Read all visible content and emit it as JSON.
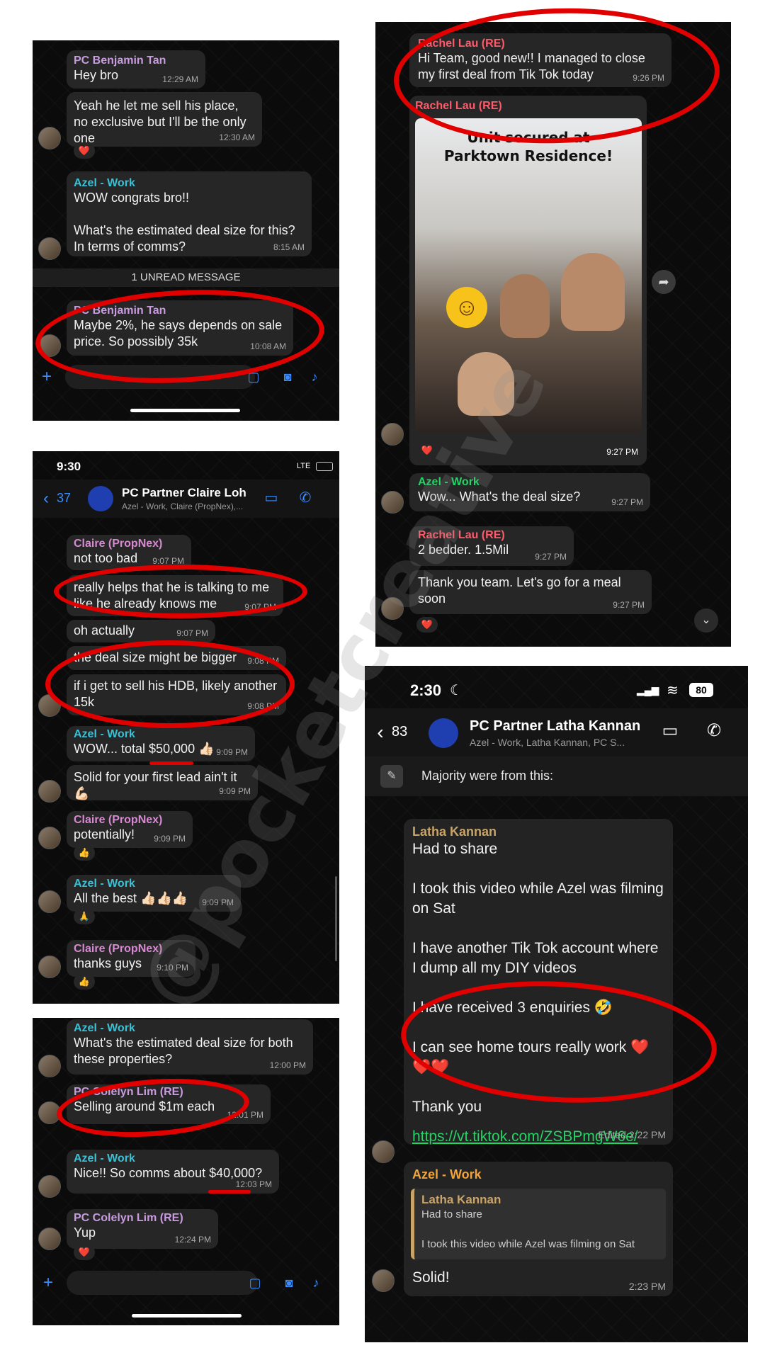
{
  "p1": {
    "m1_sender": "PC Benjamin Tan",
    "m1_text": "Hey bro",
    "m1_time": "12:29 AM",
    "m2_text": "Yeah he let me sell his place, no exclusive but I'll be the only one",
    "m2_time": "12:30 AM",
    "m2_react": "❤️",
    "m3_sender": "Azel - Work",
    "m3_text": "WOW congrats bro!!\n\nWhat's the estimated deal size for this? In terms of comms?",
    "m3_time": "8:15 AM",
    "unread": "1 UNREAD MESSAGE",
    "m4_sender": "PC Benjamin Tan",
    "m4_text": "Maybe 2%, he says depends on sale price. So possibly 35k",
    "m4_time": "10:08 AM"
  },
  "p2": {
    "status_time": "9:30",
    "status_net": "LTE",
    "back_count": "37",
    "title": "PC Partner Claire Loh",
    "subtitle": "Azel - Work, Claire (PropNex),...",
    "m1_sender": "Claire (PropNex)",
    "m1_text": "not too bad",
    "m1_time": "9:07 PM",
    "m2_text": "really helps that he is talking to me like he already knows me",
    "m2_time": "9:07 PM",
    "m3_text": "oh actually",
    "m3_time": "9:07 PM",
    "m4_text": "the deal size might be bigger",
    "m4_time": "9:08 PM",
    "m5_text": "if i get to sell his HDB, likely another 15k",
    "m5_time": "9:08 PM",
    "m6_sender": "Azel - Work",
    "m6_text": "WOW... total $50,000 👍🏻",
    "m6_time": "9:09 PM",
    "m7_text": "Solid for your first lead ain't it 💪🏻",
    "m7_time": "9:09 PM",
    "m8_sender": "Claire (PropNex)",
    "m8_text": "potentially!",
    "m8_time": "9:09 PM",
    "m8_react": "👍",
    "m9_sender": "Azel - Work",
    "m9_text": "All the best 👍🏻👍🏻👍🏻",
    "m9_time": "9:09 PM",
    "m9_react": "🙏",
    "m10_sender": "Claire (PropNex)",
    "m10_text": "thanks guys",
    "m10_time": "9:10 PM",
    "m10_react": "👍"
  },
  "p3": {
    "m1_sender": "Azel - Work",
    "m1_text": "What's the estimated deal size for both these properties?",
    "m1_time": "12:00 PM",
    "m2_sender": "PC Colelyn Lim (RE)",
    "m2_text": "Selling around $1m each",
    "m2_time": "12:01 PM",
    "m3_sender": "Azel - Work",
    "m3_text": "Nice!! So comms about $40,000?",
    "m3_time": "12:03 PM",
    "m4_sender": "PC Colelyn Lim (RE)",
    "m4_text": "Yup",
    "m4_time": "12:24 PM",
    "m4_react": "❤️"
  },
  "p4": {
    "m1_sender": "Rachel Lau (RE)",
    "m1_text": "Hi Team, good new!! I managed to close my first deal from Tik Tok today",
    "m1_time": "9:26 PM",
    "m2_sender": "Rachel Lau (RE)",
    "photo_caption": "Unit secured at Parktown Residence!",
    "photo_time": "9:27 PM",
    "photo_react": "❤️",
    "m3_sender": "Azel - Work",
    "m3_text": "Wow... What's the deal size?",
    "m3_time": "9:27 PM",
    "m4_sender": "Rachel Lau (RE)",
    "m4_text": "2 bedder. 1.5Mil",
    "m4_time": "9:27 PM",
    "m5_text": "Thank you team. Let's go for a meal soon",
    "m5_time": "9:27 PM",
    "m5_react": "❤️"
  },
  "p5": {
    "status_time": "2:30",
    "battery": "80",
    "back_count": "83",
    "title": "PC Partner Latha Kannan",
    "subtitle": "Azel - Work, Latha Kannan, PC S...",
    "pinned": "Majority were from this:",
    "m1_sender": "Latha Kannan",
    "m1_text": "Had to share\n\nI took this video while Azel was filming on Sat\n\nI have another Tik Tok account where I dump all my DIY videos\n\nI have received 3 enquiries 🤣\n\nI can see home tours really work ❤️❤️❤️\n\nThank you",
    "m1_link": "https://vt.tiktok.com/ZSBPmgW6e/",
    "m1_time": "Edited 2:22 PM",
    "m2_sender": "Azel - Work",
    "quote_sender": "Latha Kannan",
    "quote_text": "Had to share\n\nI took this video while Azel was filming on Sat",
    "m2_text": "Solid!",
    "m2_time": "2:23 PM"
  },
  "watermark": "@pocketcreative",
  "colors": {
    "red": "#e10000",
    "accent_blue": "#3a8dff",
    "azel": "#39c2d7",
    "claire": "#d78ad2",
    "benjamin": "#c99be0",
    "rachel": "#ff5a6a",
    "latha": "#c9a46a",
    "azel_latha": "#f1a33a"
  }
}
